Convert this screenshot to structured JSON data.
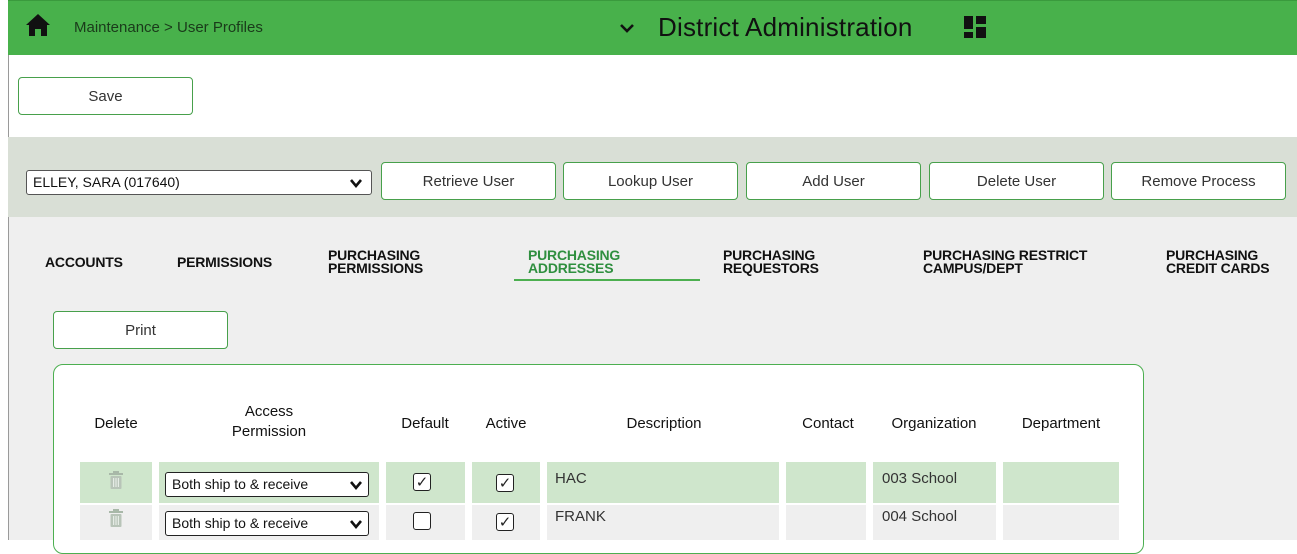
{
  "header": {
    "breadcrumb": "Maintenance > User Profiles",
    "app_title": "District Administration",
    "color": "#48b14b"
  },
  "toolbar": {
    "save_label": "Save"
  },
  "user_bar": {
    "selected_user": "ELLEY, SARA (017640)",
    "buttons": {
      "retrieve": "Retrieve User",
      "lookup": "Lookup User",
      "add": "Add User",
      "delete": "Delete User",
      "remove": "Remove Process"
    }
  },
  "tabs": {
    "accounts": "ACCOUNTS",
    "permissions": "PERMISSIONS",
    "purchasing_permissions": [
      "PURCHASING",
      "PERMISSIONS"
    ],
    "purchasing_addresses": [
      "PURCHASING",
      "ADDRESSES"
    ],
    "purchasing_requestors": [
      "PURCHASING",
      "REQUESTORS"
    ],
    "purchasing_restrict": [
      "PURCHASING RESTRICT",
      "CAMPUS/DEPT"
    ],
    "purchasing_credit_cards": [
      "PURCHASING",
      "CREDIT CARDS"
    ],
    "active": "purchasing_addresses"
  },
  "print_label": "Print",
  "table": {
    "headers": {
      "delete": "Delete",
      "access_permission": [
        "Access",
        "Permission"
      ],
      "default": "Default",
      "active": "Active",
      "description": "Description",
      "contact": "Contact",
      "organization": "Organization",
      "department": "Department"
    },
    "rows": [
      {
        "access_permission": "Both ship to & receive",
        "default": true,
        "active": true,
        "description": "HAC",
        "contact": "",
        "organization": "003 School",
        "department": ""
      },
      {
        "access_permission": "Both ship to & receive",
        "default": false,
        "active": true,
        "description": "FRANK",
        "contact": "",
        "organization": "004 School",
        "department": ""
      }
    ]
  },
  "icons": {
    "home": "home-icon",
    "title_dropdown": "chevron-down-icon",
    "app_grid": "grid-icon",
    "row_delete": "trash-icon",
    "select_arrow": "chevron-down-icon"
  }
}
